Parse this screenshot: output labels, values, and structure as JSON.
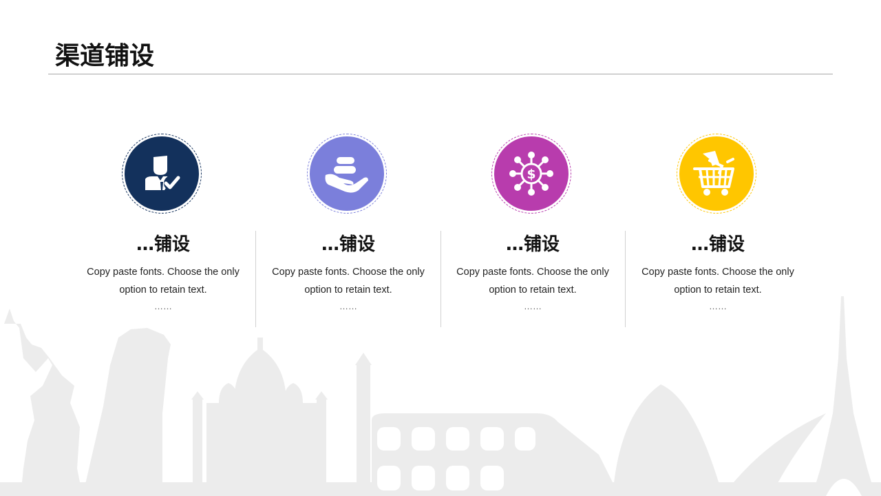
{
  "slide": {
    "title": "渠道铺设"
  },
  "cards": [
    {
      "icon": "person-check-icon",
      "color": "#13315c",
      "heading": "…铺设",
      "description": "Copy paste fonts. Choose the only option to retain text.",
      "more": "……"
    },
    {
      "icon": "hand-coins-icon",
      "color": "#7b7fdb",
      "heading": "…铺设",
      "description": "Copy paste fonts. Choose the only option to retain text.",
      "more": "……"
    },
    {
      "icon": "dollar-network-icon",
      "color": "#b83cad",
      "heading": "…铺设",
      "description": "Copy paste fonts. Choose the only option to retain text.",
      "more": "……"
    },
    {
      "icon": "shopping-cart-icon",
      "color": "#ffc600",
      "heading": "…铺设",
      "description": "Copy paste fonts. Choose the only option to retain text.",
      "more": "……"
    }
  ]
}
